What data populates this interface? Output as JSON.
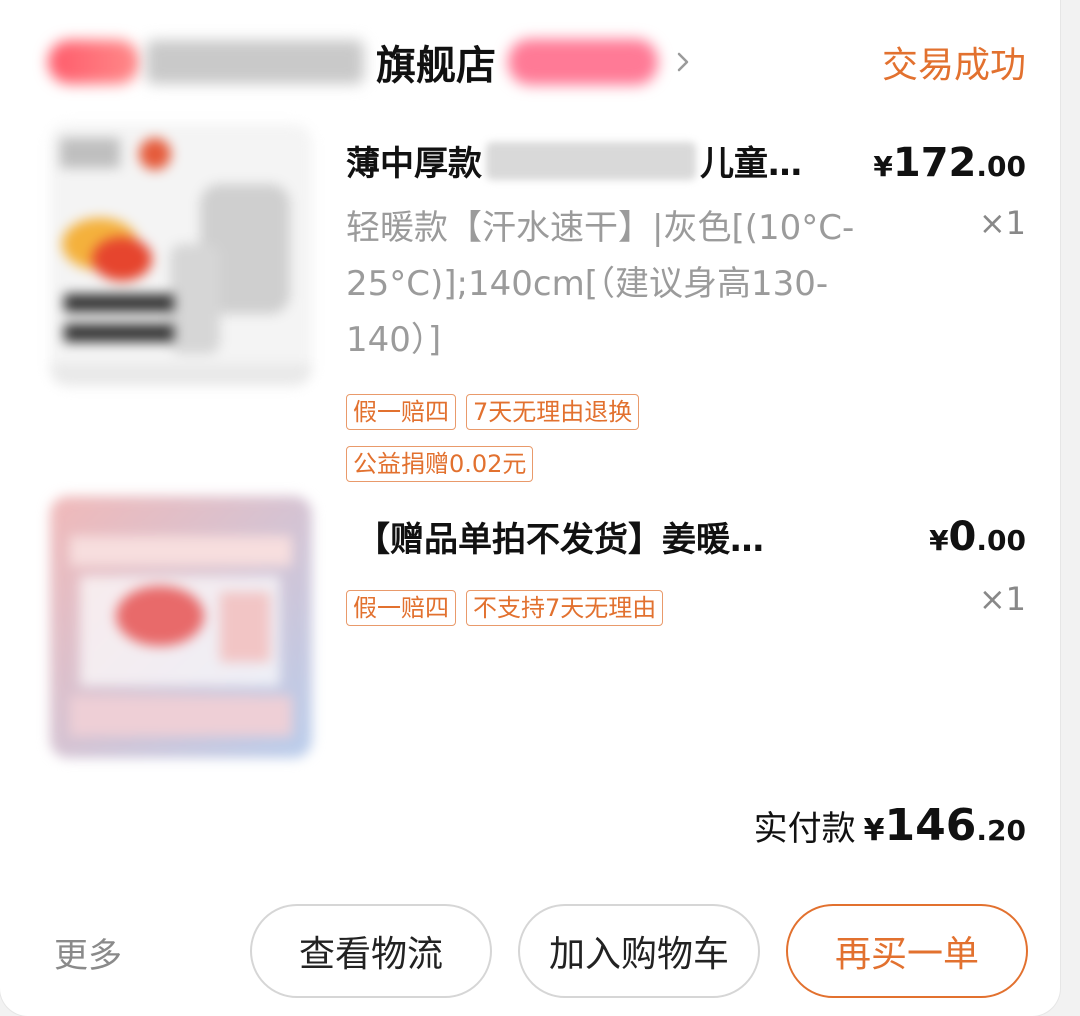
{
  "store": {
    "name": "旗舰店",
    "status": "交易成功",
    "chevron_icon": "chevron-right-icon"
  },
  "items": [
    {
      "title_prefix": "薄中厚款",
      "title_suffix": "儿童…",
      "price": {
        "currency": "¥",
        "integer": "172",
        "decimal": ".00"
      },
      "qty": "×1",
      "spec": "轻暖款【汗水速干】|灰色[(10°C-25°C)];140cm[（建议身高130-140）]",
      "tags": [
        "假一赔四",
        "7天无理由退换",
        "公益捐赠0.02元"
      ]
    },
    {
      "title": "【赠品单拍不发货】姜暖…",
      "price": {
        "currency": "¥",
        "integer": "0",
        "decimal": ".00"
      },
      "qty": "×1",
      "tags": [
        "假一赔四",
        "不支持7天无理由"
      ]
    }
  ],
  "total": {
    "label": "实付款",
    "currency": "¥",
    "integer": "146",
    "decimal": ".20"
  },
  "actions": {
    "more": "更多",
    "logistics": "查看物流",
    "add_cart": "加入购物车",
    "rebuy": "再买一单"
  },
  "colors": {
    "accent": "#e2712f",
    "muted": "#9b9b9b"
  }
}
